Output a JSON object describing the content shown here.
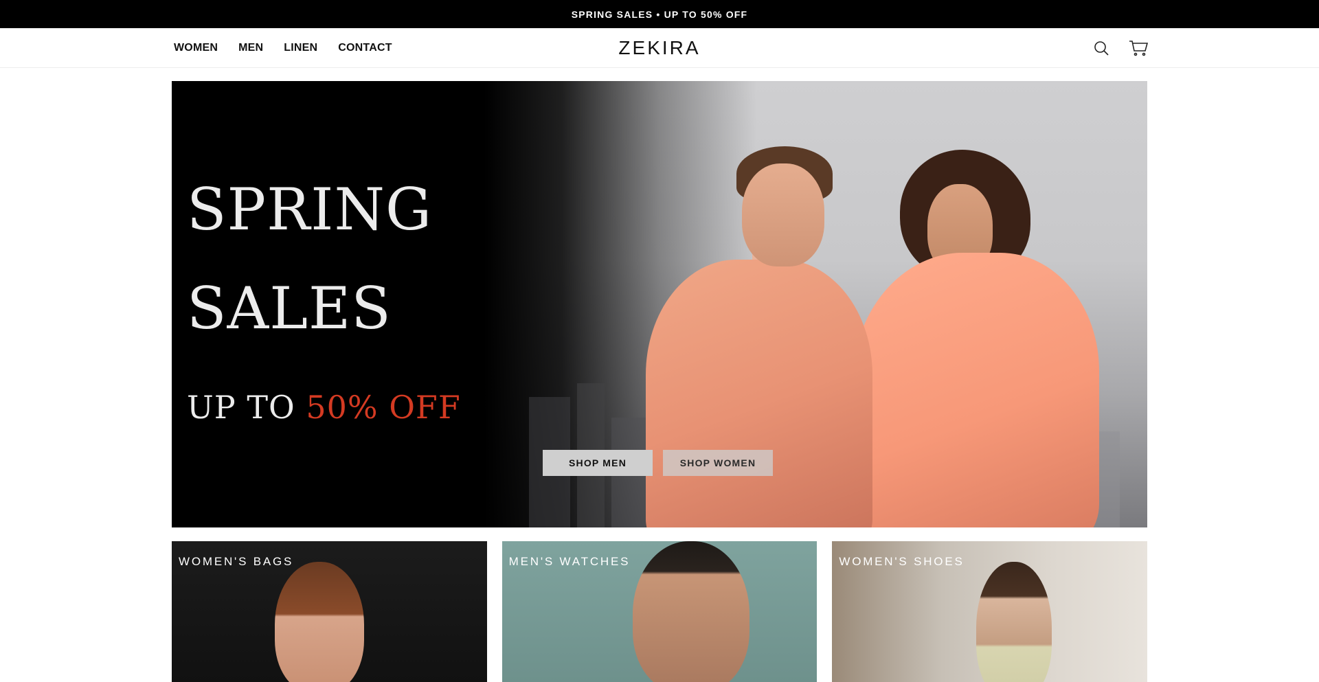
{
  "announcement": {
    "text": "SPRING SALES • UP TO 50% OFF"
  },
  "header": {
    "nav": [
      {
        "label": "WOMEN"
      },
      {
        "label": "MEN"
      },
      {
        "label": "LINEN"
      },
      {
        "label": "CONTACT"
      }
    ],
    "logo": "ZEKIRA",
    "icons": [
      "search-icon",
      "cart-icon"
    ]
  },
  "hero": {
    "line1": "SPRING",
    "line2": "SALES",
    "line3_prefix": "UP TO ",
    "line3_accent": "50% OFF",
    "accent_color": "#d43a22",
    "buttons": {
      "men": "SHOP MEN",
      "women": "SHOP WOMEN"
    }
  },
  "categories": [
    {
      "label": "WOMEN'S BAGS"
    },
    {
      "label": "MEN'S WATCHES"
    },
    {
      "label": "WOMEN'S SHOES"
    }
  ]
}
